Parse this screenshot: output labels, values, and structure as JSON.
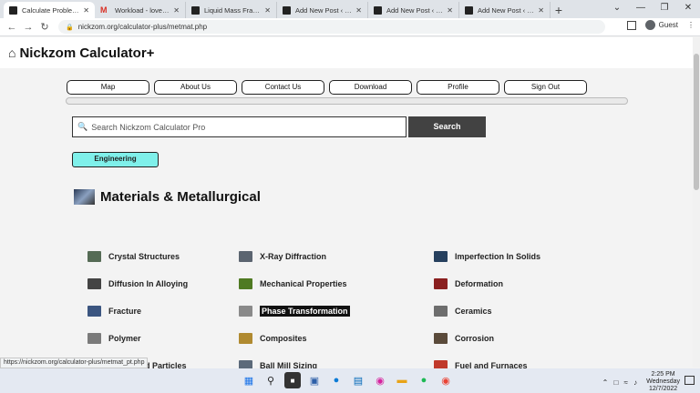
{
  "browser": {
    "tabs": [
      {
        "title": "Calculate Problems | N",
        "icon": "nickzom-icon",
        "active": true
      },
      {
        "title": "Workload - lovethidol",
        "icon": "gmail-icon",
        "active": false
      },
      {
        "title": "Liquid Mass Fraction",
        "icon": "nickzom-icon",
        "active": false
      },
      {
        "title": "Add New Post ‹ Nickz",
        "icon": "nickzom-icon",
        "active": false
      },
      {
        "title": "Add New Post ‹ Nickz",
        "icon": "nickzom-icon",
        "active": false
      },
      {
        "title": "Add New Post ‹ Nickz",
        "icon": "nickzom-icon",
        "active": false
      }
    ],
    "new_tab": "+",
    "url": "nickzom.org/calculator-plus/metmat.php",
    "profile_label": "Guest"
  },
  "header": {
    "brand": "Nickzom Calculator+"
  },
  "nav": {
    "items": [
      "Map",
      "About Us",
      "Contact Us",
      "Download",
      "Profile",
      "Sign Out"
    ]
  },
  "search": {
    "placeholder": "Search Nickzom Calculator Pro",
    "button": "Search"
  },
  "category_button": "Engineering",
  "section_title": "Materials & Metallurgical",
  "topics": [
    {
      "label": "Crystal Structures",
      "icon": "crystal-icon",
      "color": "#556b55"
    },
    {
      "label": "X-Ray Diffraction",
      "icon": "xray-icon",
      "color": "#5b6470"
    },
    {
      "label": "Imperfection In Solids",
      "icon": "imperfection-icon",
      "color": "#26405e"
    },
    {
      "label": "Diffusion In Alloying",
      "icon": "diffusion-icon",
      "color": "#444444"
    },
    {
      "label": "Mechanical Properties",
      "icon": "mechanical-icon",
      "color": "#4f7a22"
    },
    {
      "label": "Deformation",
      "icon": "deformation-icon",
      "color": "#8a1f1f"
    },
    {
      "label": "Fracture",
      "icon": "fracture-icon",
      "color": "#3b5580"
    },
    {
      "label": "Phase Transformation",
      "icon": "phase-icon",
      "color": "#8a8a8a"
    },
    {
      "label": "Ceramics",
      "icon": "ceramics-icon",
      "color": "#6d6d6d"
    },
    {
      "label": "Polymer",
      "icon": "polymer-icon",
      "color": "#7a7a7a"
    },
    {
      "label": "Composites",
      "icon": "composites-icon",
      "color": "#b08a30"
    },
    {
      "label": "Corrosion",
      "icon": "corrosion-icon",
      "color": "#5a4a3a"
    },
    {
      "label": "Fibres and Particles",
      "icon": "particles-icon",
      "color": "#6b6b6b"
    },
    {
      "label": "Ball Mill Sizing",
      "icon": "ballmill-icon",
      "color": "#5c6a7a"
    },
    {
      "label": "Fuel and Furnaces",
      "icon": "furnace-icon",
      "color": "#c0392b"
    }
  ],
  "status_url": "https://nickzom.org/calculator-plus/metmat_pt.php",
  "taskbar": {
    "time": "2:25 PM",
    "day": "Wednesday",
    "date": "12/7/2022"
  }
}
